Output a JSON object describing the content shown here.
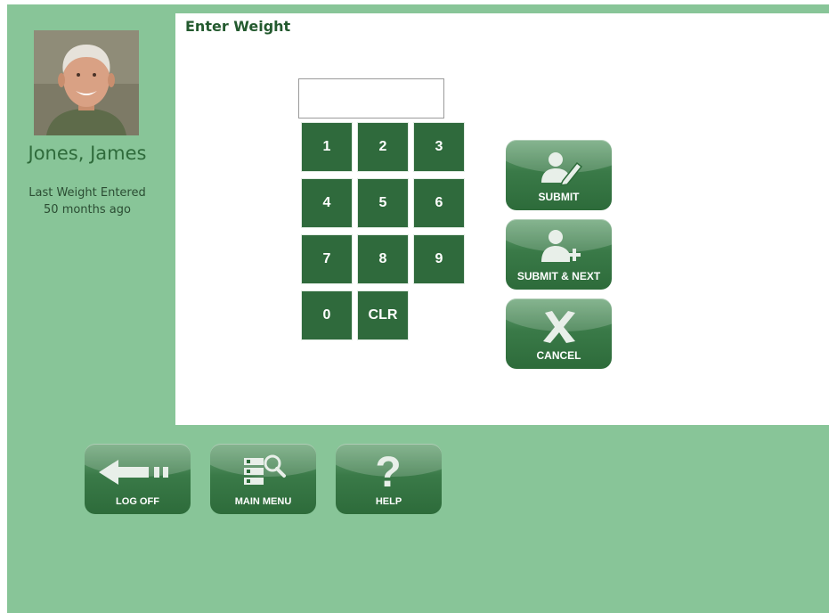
{
  "screen": {
    "title": "Enter Weight"
  },
  "patient": {
    "name": "Jones, James",
    "last_weight_line1": "Last Weight Entered",
    "last_weight_line2": "50 months ago",
    "photo_icon": "patient-photo"
  },
  "weight_input": {
    "value": "",
    "placeholder": ""
  },
  "keypad": {
    "k1": "1",
    "k2": "2",
    "k3": "3",
    "k4": "4",
    "k5": "5",
    "k6": "6",
    "k7": "7",
    "k8": "8",
    "k9": "9",
    "k0": "0",
    "clr": "CLR"
  },
  "actions": {
    "submit": {
      "label": "SUBMIT",
      "icon": "user-edit-icon"
    },
    "submit_next": {
      "label": "SUBMIT & NEXT",
      "icon": "user-add-icon"
    },
    "cancel": {
      "label": "CANCEL",
      "icon": "cancel-x-icon"
    }
  },
  "footer": {
    "log_off": {
      "label": "LOG OFF",
      "icon": "back-arrow-icon"
    },
    "main_menu": {
      "label": "MAIN MENU",
      "icon": "menu-search-icon"
    },
    "help": {
      "label": "HELP",
      "icon": "question-mark-icon"
    }
  },
  "colors": {
    "background_green": "#88c598",
    "key_green": "#2f6a3c",
    "text_green": "#2f6b3b"
  }
}
